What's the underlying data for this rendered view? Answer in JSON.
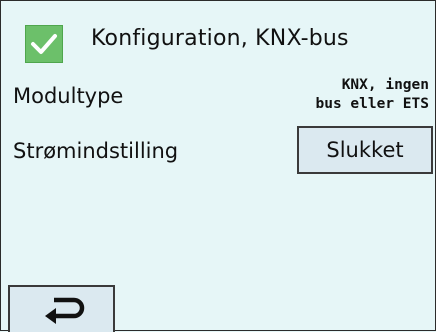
{
  "header": {
    "title": "Konfiguration, KNX-bus",
    "checked": true,
    "check_color": "#6cc06a"
  },
  "rows": {
    "modultype": {
      "label": "Modultype",
      "value_line1": "KNX, ingen",
      "value_line2": "bus eller ETS"
    },
    "stroemindstilling": {
      "label": "Strømindstilling",
      "value": "Slukket"
    }
  },
  "footer": {
    "back_icon": "return-arrow-icon"
  },
  "colors": {
    "background": "#e6f6f7",
    "button_fill": "#dbe9f0",
    "border": "#3a3a3a"
  }
}
